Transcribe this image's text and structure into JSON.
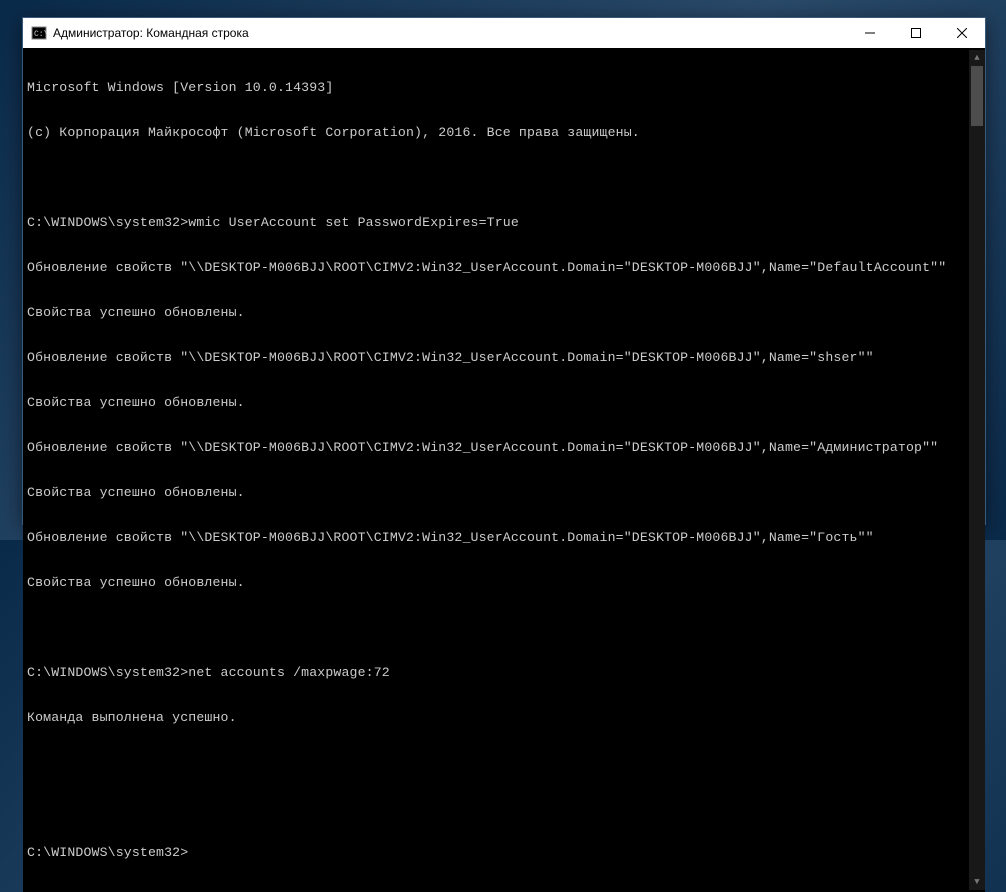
{
  "window": {
    "title": "Администратор: Командная строка"
  },
  "console": {
    "lines": [
      "Microsoft Windows [Version 10.0.14393]",
      "(c) Корпорация Майкрософт (Microsoft Corporation), 2016. Все права защищены.",
      "",
      "C:\\WINDOWS\\system32>wmic UserAccount set PasswordExpires=True",
      "Обновление свойств \"\\\\DESKTOP-M006BJJ\\ROOT\\CIMV2:Win32_UserAccount.Domain=\"DESKTOP-M006BJJ\",Name=\"DefaultAccount\"\"",
      "Свойства успешно обновлены.",
      "Обновление свойств \"\\\\DESKTOP-M006BJJ\\ROOT\\CIMV2:Win32_UserAccount.Domain=\"DESKTOP-M006BJJ\",Name=\"shser\"\"",
      "Свойства успешно обновлены.",
      "Обновление свойств \"\\\\DESKTOP-M006BJJ\\ROOT\\CIMV2:Win32_UserAccount.Domain=\"DESKTOP-M006BJJ\",Name=\"Администратор\"\"",
      "Свойства успешно обновлены.",
      "Обновление свойств \"\\\\DESKTOP-M006BJJ\\ROOT\\CIMV2:Win32_UserAccount.Domain=\"DESKTOP-M006BJJ\",Name=\"Гость\"\"",
      "Свойства успешно обновлены.",
      "",
      "C:\\WINDOWS\\system32>net accounts /maxpwage:72",
      "Команда выполнена успешно.",
      "",
      "",
      "C:\\WINDOWS\\system32>"
    ]
  }
}
